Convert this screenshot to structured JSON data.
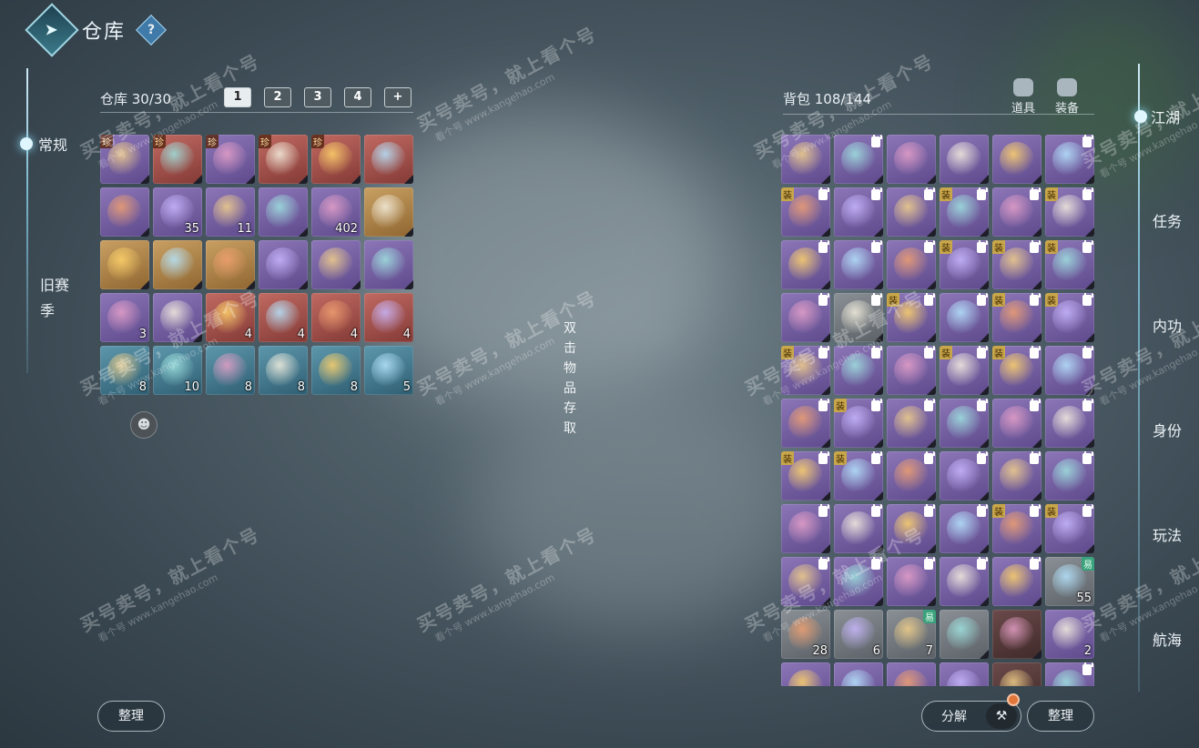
{
  "header": {
    "title": "仓库",
    "help": "?"
  },
  "left_nav": {
    "active": "常规",
    "old_season": "旧赛季"
  },
  "warehouse": {
    "count_label": "仓库 30/30",
    "tabs": [
      "1",
      "2",
      "3",
      "4",
      ""
    ],
    "items": [
      {
        "rarity": "purple",
        "tag": "珍",
        "count": ""
      },
      {
        "rarity": "red",
        "tag": "珍",
        "count": ""
      },
      {
        "rarity": "purple",
        "tag": "珍",
        "count": ""
      },
      {
        "rarity": "red",
        "tag": "珍",
        "count": ""
      },
      {
        "rarity": "red",
        "tag": "珍",
        "count": ""
      },
      {
        "rarity": "red",
        "tag": "",
        "count": ""
      },
      {
        "rarity": "purple",
        "tag": "",
        "count": ""
      },
      {
        "rarity": "purple",
        "tag": "",
        "count": "35"
      },
      {
        "rarity": "purple",
        "tag": "",
        "count": "11"
      },
      {
        "rarity": "purple",
        "tag": "",
        "count": ""
      },
      {
        "rarity": "purple",
        "tag": "",
        "count": "402"
      },
      {
        "rarity": "gold",
        "tag": "",
        "count": ""
      },
      {
        "rarity": "gold",
        "tag": "",
        "count": ""
      },
      {
        "rarity": "gold",
        "tag": "",
        "count": ""
      },
      {
        "rarity": "gold",
        "tag": "",
        "count": ""
      },
      {
        "rarity": "purple",
        "tag": "",
        "count": ""
      },
      {
        "rarity": "purple",
        "tag": "",
        "count": ""
      },
      {
        "rarity": "purple",
        "tag": "",
        "count": ""
      },
      {
        "rarity": "purple",
        "tag": "",
        "count": "3"
      },
      {
        "rarity": "purple",
        "tag": "",
        "count": ""
      },
      {
        "rarity": "red",
        "tag": "",
        "count": "4"
      },
      {
        "rarity": "red",
        "tag": "",
        "count": "4"
      },
      {
        "rarity": "red",
        "tag": "",
        "count": "4"
      },
      {
        "rarity": "red",
        "tag": "",
        "count": "4"
      },
      {
        "rarity": "teal",
        "tag": "",
        "count": "8"
      },
      {
        "rarity": "teal",
        "tag": "",
        "count": "10"
      },
      {
        "rarity": "teal",
        "tag": "",
        "count": "8"
      },
      {
        "rarity": "teal",
        "tag": "",
        "count": "8"
      },
      {
        "rarity": "teal",
        "tag": "",
        "count": "8"
      },
      {
        "rarity": "teal",
        "tag": "",
        "count": "5"
      }
    ]
  },
  "hint": "双击物品存取",
  "bag": {
    "count_label": "背包 108/144",
    "filters": [
      {
        "label": "道具",
        "icon": "potion-icon"
      },
      {
        "label": "装备",
        "icon": "armor-icon"
      }
    ],
    "items": [
      {
        "rarity": "purple",
        "tag": "",
        "lock": false,
        "count": ""
      },
      {
        "rarity": "purple",
        "tag": "",
        "lock": true,
        "count": ""
      },
      {
        "rarity": "purple",
        "tag": "",
        "lock": false,
        "count": ""
      },
      {
        "rarity": "purple",
        "tag": "",
        "lock": false,
        "count": ""
      },
      {
        "rarity": "purple",
        "tag": "",
        "lock": false,
        "count": ""
      },
      {
        "rarity": "purple",
        "tag": "",
        "lock": true,
        "count": ""
      },
      {
        "rarity": "purple",
        "tag": "装",
        "lock": true,
        "count": ""
      },
      {
        "rarity": "purple",
        "tag": "",
        "lock": true,
        "count": ""
      },
      {
        "rarity": "purple",
        "tag": "",
        "lock": true,
        "count": ""
      },
      {
        "rarity": "purple",
        "tag": "装",
        "lock": true,
        "count": ""
      },
      {
        "rarity": "purple",
        "tag": "",
        "lock": true,
        "count": ""
      },
      {
        "rarity": "purple",
        "tag": "装",
        "lock": true,
        "count": ""
      },
      {
        "rarity": "purple",
        "tag": "",
        "lock": true,
        "count": ""
      },
      {
        "rarity": "purple",
        "tag": "",
        "lock": true,
        "count": ""
      },
      {
        "rarity": "purple",
        "tag": "",
        "lock": true,
        "count": ""
      },
      {
        "rarity": "purple",
        "tag": "装",
        "lock": true,
        "count": ""
      },
      {
        "rarity": "purple",
        "tag": "装",
        "lock": true,
        "count": ""
      },
      {
        "rarity": "purple",
        "tag": "装",
        "lock": true,
        "count": ""
      },
      {
        "rarity": "purple",
        "tag": "",
        "lock": true,
        "count": ""
      },
      {
        "rarity": "gray",
        "tag": "",
        "lock": true,
        "count": ""
      },
      {
        "rarity": "purple",
        "tag": "装",
        "lock": true,
        "count": ""
      },
      {
        "rarity": "purple",
        "tag": "",
        "lock": true,
        "count": ""
      },
      {
        "rarity": "purple",
        "tag": "装",
        "lock": true,
        "count": ""
      },
      {
        "rarity": "purple",
        "tag": "装",
        "lock": true,
        "count": ""
      },
      {
        "rarity": "purple",
        "tag": "装",
        "lock": true,
        "count": ""
      },
      {
        "rarity": "purple",
        "tag": "",
        "lock": true,
        "count": ""
      },
      {
        "rarity": "purple",
        "tag": "",
        "lock": true,
        "count": ""
      },
      {
        "rarity": "purple",
        "tag": "装",
        "lock": true,
        "count": ""
      },
      {
        "rarity": "purple",
        "tag": "装",
        "lock": true,
        "count": ""
      },
      {
        "rarity": "purple",
        "tag": "",
        "lock": true,
        "count": ""
      },
      {
        "rarity": "purple",
        "tag": "",
        "lock": true,
        "count": ""
      },
      {
        "rarity": "purple",
        "tag": "装",
        "lock": true,
        "count": ""
      },
      {
        "rarity": "purple",
        "tag": "",
        "lock": true,
        "count": ""
      },
      {
        "rarity": "purple",
        "tag": "",
        "lock": true,
        "count": ""
      },
      {
        "rarity": "purple",
        "tag": "",
        "lock": true,
        "count": ""
      },
      {
        "rarity": "purple",
        "tag": "",
        "lock": true,
        "count": ""
      },
      {
        "rarity": "purple",
        "tag": "装",
        "lock": true,
        "count": ""
      },
      {
        "rarity": "purple",
        "tag": "装",
        "lock": true,
        "count": ""
      },
      {
        "rarity": "purple",
        "tag": "",
        "lock": true,
        "count": ""
      },
      {
        "rarity": "purple",
        "tag": "",
        "lock": true,
        "count": ""
      },
      {
        "rarity": "purple",
        "tag": "",
        "lock": true,
        "count": ""
      },
      {
        "rarity": "purple",
        "tag": "",
        "lock": true,
        "count": ""
      },
      {
        "rarity": "purple",
        "tag": "",
        "lock": true,
        "count": ""
      },
      {
        "rarity": "purple",
        "tag": "",
        "lock": true,
        "count": ""
      },
      {
        "rarity": "purple",
        "tag": "",
        "lock": true,
        "count": ""
      },
      {
        "rarity": "purple",
        "tag": "",
        "lock": true,
        "count": ""
      },
      {
        "rarity": "purple",
        "tag": "装",
        "lock": true,
        "count": ""
      },
      {
        "rarity": "purple",
        "tag": "装",
        "lock": true,
        "count": ""
      },
      {
        "rarity": "purple",
        "tag": "",
        "lock": true,
        "count": ""
      },
      {
        "rarity": "purple",
        "tag": "",
        "lock": true,
        "count": ""
      },
      {
        "rarity": "purple",
        "tag": "",
        "lock": true,
        "count": ""
      },
      {
        "rarity": "purple",
        "tag": "",
        "lock": true,
        "count": ""
      },
      {
        "rarity": "purple",
        "tag": "",
        "lock": true,
        "count": ""
      },
      {
        "rarity": "gray",
        "tag": "易",
        "lock": false,
        "count": "55"
      },
      {
        "rarity": "gray",
        "tag": "",
        "lock": false,
        "count": "28"
      },
      {
        "rarity": "gray",
        "tag": "",
        "lock": false,
        "count": "6"
      },
      {
        "rarity": "gray",
        "tag": "易",
        "lock": false,
        "count": "7"
      },
      {
        "rarity": "gray",
        "tag": "",
        "lock": false,
        "count": ""
      },
      {
        "rarity": "dark",
        "tag": "",
        "lock": false,
        "count": ""
      },
      {
        "rarity": "purple",
        "tag": "",
        "lock": false,
        "count": "2"
      },
      {
        "rarity": "purple",
        "tag": "",
        "lock": false,
        "count": ""
      },
      {
        "rarity": "purple",
        "tag": "",
        "lock": false,
        "count": ""
      },
      {
        "rarity": "purple",
        "tag": "",
        "lock": false,
        "count": ""
      },
      {
        "rarity": "purple",
        "tag": "",
        "lock": false,
        "count": ""
      },
      {
        "rarity": "dark",
        "tag": "",
        "lock": false,
        "count": ""
      },
      {
        "rarity": "purple",
        "tag": "",
        "lock": true,
        "count": ""
      }
    ]
  },
  "right_nav": {
    "active": "江湖",
    "items": [
      "任务",
      "内功",
      "身份",
      "玩法",
      "航海"
    ]
  },
  "buttons": {
    "sort_left": "整理",
    "decompose": "分解",
    "sort_right": "整理"
  },
  "watermark": {
    "main": "买号卖号，就上看个号",
    "sub": "看个号  www.kangehao.com"
  }
}
